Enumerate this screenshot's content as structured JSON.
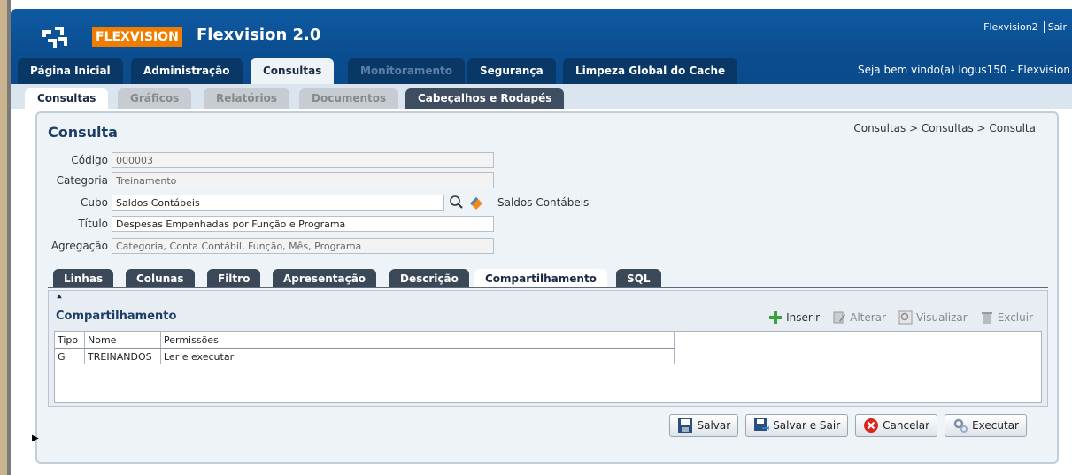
{
  "header": {
    "logo_text": "FLEXVISION",
    "app_title": "Flexvision 2.0",
    "user_link": "Flexvision2",
    "logout_link": "Sair",
    "welcome": "Seja bem vindo(a) logus150 - Flexvision"
  },
  "main_tabs": [
    {
      "label": "Página Inicial"
    },
    {
      "label": "Administração"
    },
    {
      "label": "Consultas"
    },
    {
      "label": "Monitoramento"
    },
    {
      "label": "Segurança"
    },
    {
      "label": "Limpeza Global do Cache"
    }
  ],
  "sub_tabs": [
    {
      "label": "Consultas"
    },
    {
      "label": "Gráficos"
    },
    {
      "label": "Relatórios"
    },
    {
      "label": "Documentos"
    },
    {
      "label": "Cabeçalhos e Rodapés"
    }
  ],
  "page": {
    "title": "Consulta",
    "breadcrumb": "Consultas > Consultas > Consulta"
  },
  "form": {
    "codigo_label": "Código",
    "codigo_value": "000003",
    "categoria_label": "Categoria",
    "categoria_value": "Treinamento",
    "cubo_label": "Cubo",
    "cubo_value": "Saldos Contábeis",
    "cubo_description": "Saldos Contábeis",
    "titulo_label": "Título",
    "titulo_value": "Despesas Empenhadas por Função e Programa",
    "agregacao_label": "Agregação",
    "agregacao_value": "Categoria, Conta Contábil, Função, Mês, Programa"
  },
  "inner_tabs": [
    {
      "label": "Linhas"
    },
    {
      "label": "Colunas"
    },
    {
      "label": "Filtro"
    },
    {
      "label": "Apresentação"
    },
    {
      "label": "Descrição"
    },
    {
      "label": "Compartilhamento"
    },
    {
      "label": "SQL"
    }
  ],
  "sharing": {
    "title": "Compartilhamento",
    "actions": {
      "insert": "Inserir",
      "edit": "Alterar",
      "view": "Visualizar",
      "delete": "Excluir"
    },
    "columns": [
      "Tipo",
      "Nome",
      "Permissões"
    ],
    "rows": [
      [
        "G",
        "TREINANDOS",
        "Ler e executar"
      ]
    ]
  },
  "buttons": {
    "save": "Salvar",
    "save_exit": "Salvar e Sair",
    "cancel": "Cancelar",
    "execute": "Executar"
  },
  "colors": {
    "header_blue": "#0b4f92",
    "logo_orange": "#f07d00",
    "tab_dark": "#093766"
  }
}
